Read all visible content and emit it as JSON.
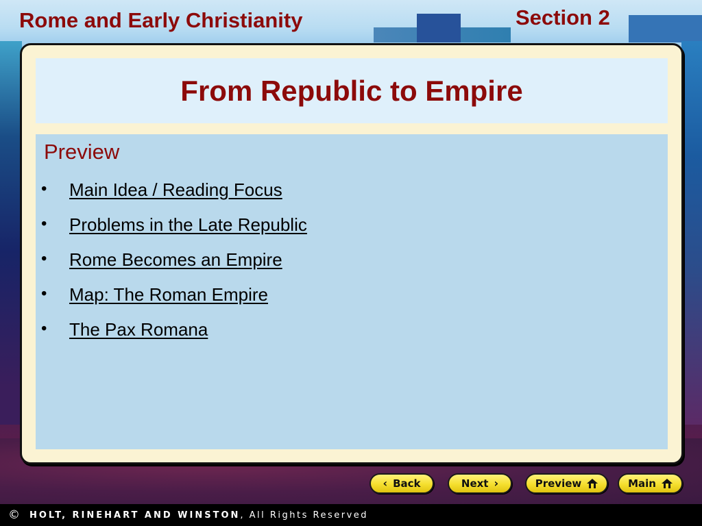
{
  "header": {
    "chapter_title": "Rome and Early Christianity",
    "section_label": "Section 2"
  },
  "slide": {
    "title": "From Republic to Empire",
    "preview_heading": "Preview",
    "bullet_glyph": "•",
    "links": [
      {
        "label": "Main Idea / Reading Focus"
      },
      {
        "label": "Problems in the Late Republic"
      },
      {
        "label": "Rome Becomes an Empire"
      },
      {
        "label": "Map: The Roman Empire"
      },
      {
        "label": "The Pax Romana"
      }
    ]
  },
  "navigation": {
    "back": {
      "label": "Back",
      "icon": "chevron-left-icon",
      "glyph": "‹"
    },
    "next": {
      "label": "Next",
      "icon": "chevron-right-icon",
      "glyph": "›"
    },
    "preview": {
      "label": "Preview",
      "icon": "home-icon"
    },
    "main": {
      "label": "Main",
      "icon": "home-icon"
    }
  },
  "footer": {
    "copyright_symbol": "©",
    "company": "HOLT, RINEHART AND WINSTON",
    "rights": ", All Rights Reserved"
  },
  "colors": {
    "title_red": "#8c0a0a",
    "button_yellow": "#f5df2e",
    "card_cream": "#fbf3d3",
    "content_blue": "#b9d9ec",
    "title_box_blue": "#dff0fb"
  }
}
